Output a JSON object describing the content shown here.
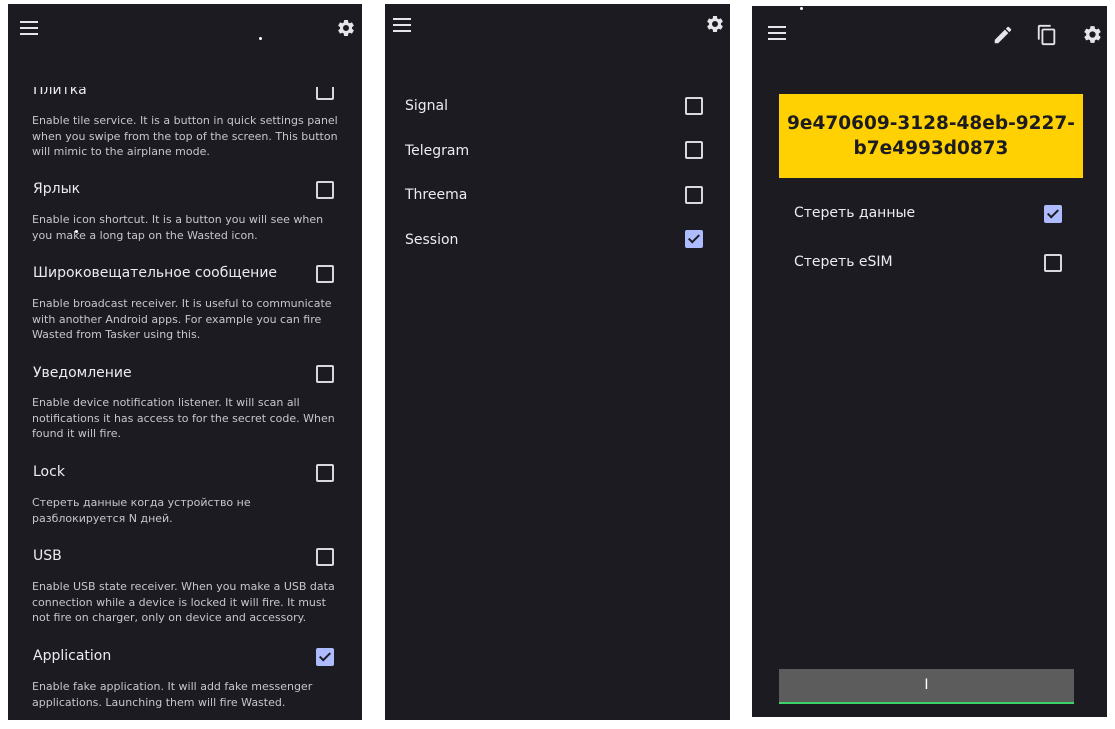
{
  "settings_panel": {
    "items": [
      {
        "title": "Плитка",
        "description": "Enable tile service. It is a button in quick settings panel when you swipe from the top of the screen. This button will mimic to the airplane mode.",
        "checked": false
      },
      {
        "title": "Ярлык",
        "description": "Enable icon shortcut. It is a button you will see when you make a long tap on the Wasted icon.",
        "checked": false
      },
      {
        "title": "Широковещательное сообщение",
        "description": "Enable broadcast receiver. It is useful to communicate with another Android apps. For example you can fire Wasted from Tasker using this.",
        "checked": false
      },
      {
        "title": "Уведомление",
        "description": "Enable device notification listener. It will scan all notifications it has access to for the secret code. When found it will fire.",
        "checked": false
      },
      {
        "title": "Lock",
        "description": "Стереть данные когда устройство не разблокируется N дней.",
        "checked": false
      },
      {
        "title": "USB",
        "description": "Enable USB state receiver. When you make a USB data connection while a device is locked it will fire. It must not fire on charger, only on device and accessory.",
        "checked": false
      },
      {
        "title": "Application",
        "description": "Enable fake application. It will add fake messenger applications. Launching them will fire Wasted.",
        "checked": true
      }
    ]
  },
  "apps_panel": {
    "items": [
      {
        "label": "Signal",
        "checked": false
      },
      {
        "label": "Telegram",
        "checked": false
      },
      {
        "label": "Threema",
        "checked": false
      },
      {
        "label": "Session",
        "checked": true
      }
    ]
  },
  "main_panel": {
    "secret_code": "9e470609-3128-48eb-9227-b7e4993d0873",
    "options": [
      {
        "label": "Стереть данные",
        "checked": true
      },
      {
        "label": "Стереть eSIM",
        "checked": false
      }
    ],
    "toggle_button_label": "I"
  },
  "icons": {
    "menu": "menu-icon",
    "settings": "gear-icon",
    "edit": "pencil-icon",
    "copy": "copy-icon"
  },
  "colors": {
    "background": "#1c1b21",
    "code_background": "#ffd102",
    "checkbox_checked": "#aebcff",
    "accent_line": "#3dd36a"
  }
}
